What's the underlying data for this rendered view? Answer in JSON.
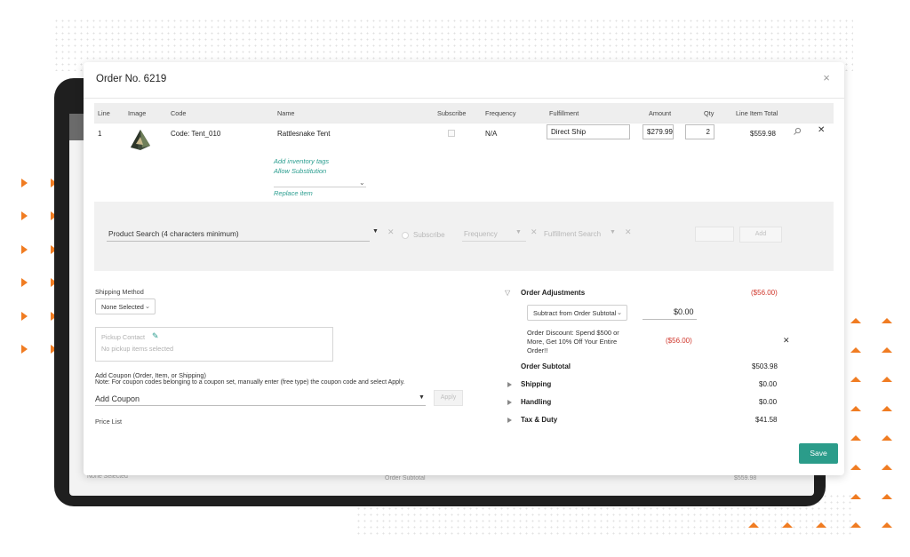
{
  "modal": {
    "title": "Order No. 6219",
    "close_icon": "×"
  },
  "table": {
    "headers": [
      "Line",
      "Image",
      "Code",
      "Name",
      "Subscribe",
      "Frequency",
      "Fulfillment",
      "Amount",
      "Qty",
      "Line Item Total"
    ],
    "row": {
      "line": "1",
      "code": "Code: Tent_010",
      "name": "Rattlesnake Tent",
      "frequency": "N/A",
      "fulfillment": "Direct Ship",
      "amount": "$279.99",
      "qty": "2",
      "total": "$559.98",
      "links": {
        "inventory_tags": "Add inventory tags",
        "allow_substitution": "Allow Substitution",
        "replace_item": "Replace item"
      }
    }
  },
  "product_search": {
    "placeholder": "Product Search (4 characters minimum)",
    "subscribe": "Subscribe",
    "frequency": "Frequency",
    "fulfillment_search": "Fulfillment Search",
    "add": "Add"
  },
  "shipping": {
    "label": "Shipping Method",
    "value": "None Selected"
  },
  "pickup": {
    "label": "Pickup Contact",
    "placeholder": "No pickup items selected"
  },
  "coupon": {
    "label": "Add Coupon (Order, Item, or Shipping)",
    "note": "Note: For coupon codes belonging to a coupon set, manually enter (free type) the coupon code and select Apply.",
    "placeholder": "Add Coupon",
    "apply": "Apply"
  },
  "price_list": {
    "label": "Price List"
  },
  "summary": {
    "adjustments_label": "Order Adjustments",
    "adjustments_total": "($56.00)",
    "adjust_mode": "Subtract from Order Subtotal",
    "adjust_amount": "$0.00",
    "discount_text": "Order Discount: Spend $500 or More, Get 10% Off Your Entire Order!!",
    "discount_amount": "($56.00)",
    "subtotal_label": "Order Subtotal",
    "subtotal_value": "$503.98",
    "shipping_label": "Shipping",
    "shipping_value": "$0.00",
    "handling_label": "Handling",
    "handling_value": "$0.00",
    "tax_label": "Tax & Duty",
    "tax_value": "$41.58"
  },
  "save": "Save",
  "background": {
    "subtotal_label": "Order Subtotal",
    "subtotal_value": "$559.98",
    "none_selected": "None Selected"
  },
  "colors": {
    "accent": "#2b9c8a",
    "link": "#2a9d8f",
    "negative": "#d0362b",
    "marker": "#f07c22"
  }
}
